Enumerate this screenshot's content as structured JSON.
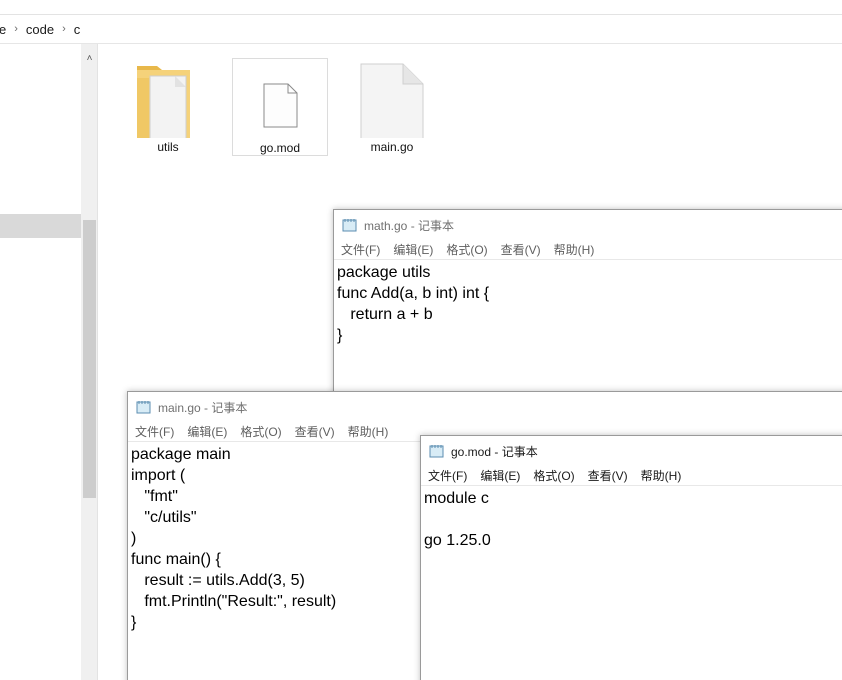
{
  "explorer": {
    "breadcrumbs": [
      "e",
      "code",
      "c"
    ],
    "scroll_up_glyph": "˄",
    "files": [
      {
        "name": "utils",
        "icon": "folder-icon"
      },
      {
        "name": "go.mod",
        "icon": "file-icon"
      },
      {
        "name": "main.go",
        "icon": "file-icon"
      }
    ]
  },
  "notepads": {
    "math": {
      "title": "math.go - 记事本",
      "menu": [
        "文件(F)",
        "编辑(E)",
        "格式(O)",
        "查看(V)",
        "帮助(H)"
      ],
      "content": "package utils\nfunc Add(a, b int) int {\n   return a + b\n}"
    },
    "main": {
      "title": "main.go - 记事本",
      "menu": [
        "文件(F)",
        "编辑(E)",
        "格式(O)",
        "查看(V)",
        "帮助(H)"
      ],
      "content": "package main\nimport (\n   \"fmt\"\n   \"c/utils\"\n)\nfunc main() {\n   result := utils.Add(3, 5)\n   fmt.Println(\"Result:\", result)\n}"
    },
    "gomod": {
      "title": "go.mod - 记事本",
      "menu": [
        "文件(F)",
        "编辑(E)",
        "格式(O)",
        "查看(V)",
        "帮助(H)"
      ],
      "content": "module c\n\ngo 1.25.0"
    }
  },
  "colors": {
    "folder": "#f5d27a",
    "selection": "#d9d9d9",
    "title_text": "#707070"
  }
}
